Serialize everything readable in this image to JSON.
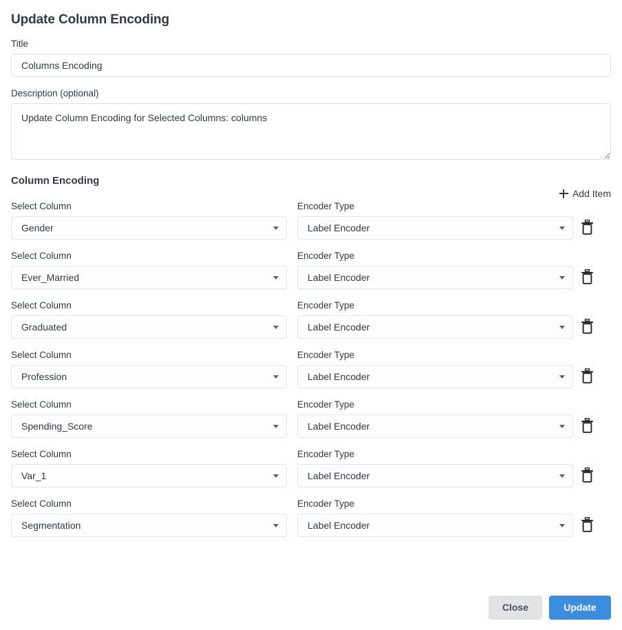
{
  "modal": {
    "title": "Update Column Encoding"
  },
  "title_field": {
    "label": "Title",
    "value": "Columns Encoding",
    "placeholder": "Title"
  },
  "description_field": {
    "label": "Description (optional)",
    "value": "Update Column Encoding for Selected Columns: columns",
    "placeholder": "Description (optional)"
  },
  "section": {
    "title": "Column Encoding",
    "add_item_label": "Add Item",
    "add_item_icon": "plus-icon"
  },
  "row_labels": {
    "column_label": "Select Column",
    "encoder_label": "Encoder Type",
    "delete_icon": "trash-icon"
  },
  "encoding_rows": [
    {
      "column": "Gender",
      "encoder": "Label Encoder"
    },
    {
      "column": "Ever_Married",
      "encoder": "Label Encoder"
    },
    {
      "column": "Graduated",
      "encoder": "Label Encoder"
    },
    {
      "column": "Profession",
      "encoder": "Label Encoder"
    },
    {
      "column": "Spending_Score",
      "encoder": "Label Encoder"
    },
    {
      "column": "Var_1",
      "encoder": "Label Encoder"
    },
    {
      "column": "Segmentation",
      "encoder": "Label Encoder"
    }
  ],
  "footer": {
    "close_label": "Close",
    "update_label": "Update"
  },
  "colors": {
    "primary": "#3c8dde",
    "secondary": "#e2e3e5",
    "text": "#343a40",
    "border": "#dee2e6",
    "background": "#ffffff"
  }
}
